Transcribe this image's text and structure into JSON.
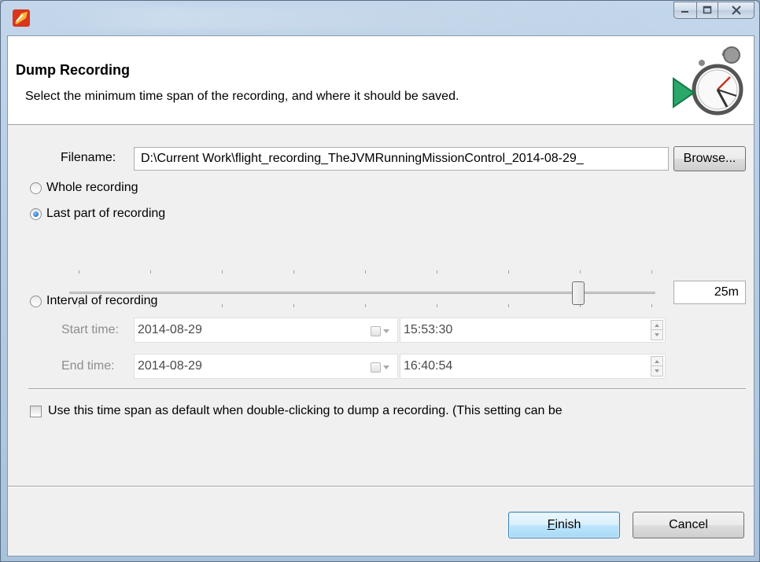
{
  "window": {
    "caption_buttons": [
      "minimize-icon",
      "maximize-icon",
      "close-icon"
    ]
  },
  "header": {
    "title": "Dump Recording",
    "description": "Select the minimum time span of the recording, and where it should be saved."
  },
  "filename": {
    "label": "Filename:",
    "value": "D:\\Current Work\\flight_recording_TheJVMRunningMissionControl_2014-08-29_",
    "browse_label": "Browse..."
  },
  "options": {
    "whole_recording": "Whole recording",
    "last_part": "Last part of recording",
    "interval": "Interval of recording",
    "selected": "last_part"
  },
  "slider": {
    "value_label": "25m"
  },
  "interval": {
    "start_label": "Start time:",
    "start_date": "2014-08-29",
    "start_time": "15:53:30",
    "end_label": "End time:",
    "end_date": "2014-08-29",
    "end_time": "16:40:54"
  },
  "default_checkbox": {
    "label": "Use this time span as default when double-clicking to dump a recording. (This setting can be",
    "checked": false
  },
  "buttons": {
    "finish_mnemonic": "F",
    "finish_rest": "inish",
    "cancel": "Cancel"
  },
  "colors": {
    "accent": "#3c7fb1",
    "dialog_bg": "#f0f0f0"
  }
}
